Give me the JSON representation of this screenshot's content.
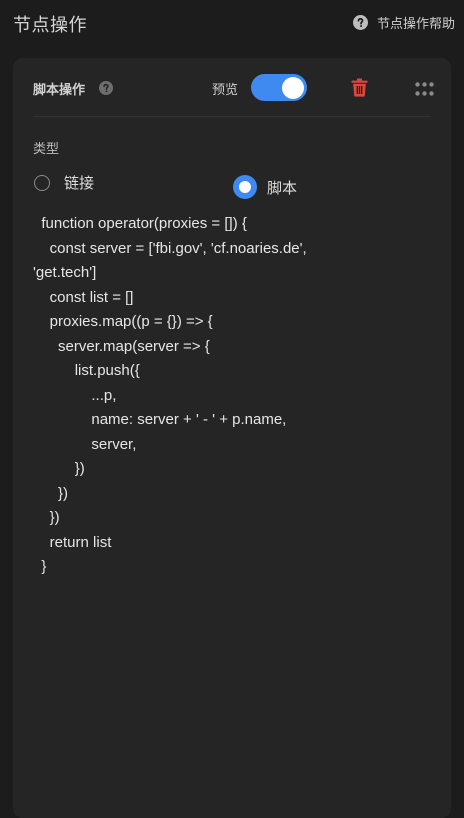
{
  "header": {
    "title": "节点操作",
    "help_label": "节点操作帮助",
    "help_icon": "question-circle-icon"
  },
  "card": {
    "title": "脚本操作",
    "title_icon": "question-circle-icon",
    "preview_label": "预览",
    "preview_enabled": true,
    "delete_icon": "trash-icon",
    "drag_icon": "grip-icon",
    "type_label": "类型",
    "options": [
      {
        "label": "链接",
        "selected": false
      },
      {
        "label": "脚本",
        "selected": true
      }
    ],
    "code": "  function operator(proxies = []) {\n    const server = ['fbi.gov', 'cf.noaries.de',\n'get.tech']\n    const list = []\n    proxies.map((p = {}) => {\n      server.map(server => {\n          list.push({\n              ...p,\n              name: server + ' - ' + p.name,\n              server,\n          })\n      })\n    })\n    return list\n  }"
  },
  "colors": {
    "background": "#1c1c1c",
    "card": "#252525",
    "accent": "#3f8af0",
    "danger": "#e0463c"
  }
}
